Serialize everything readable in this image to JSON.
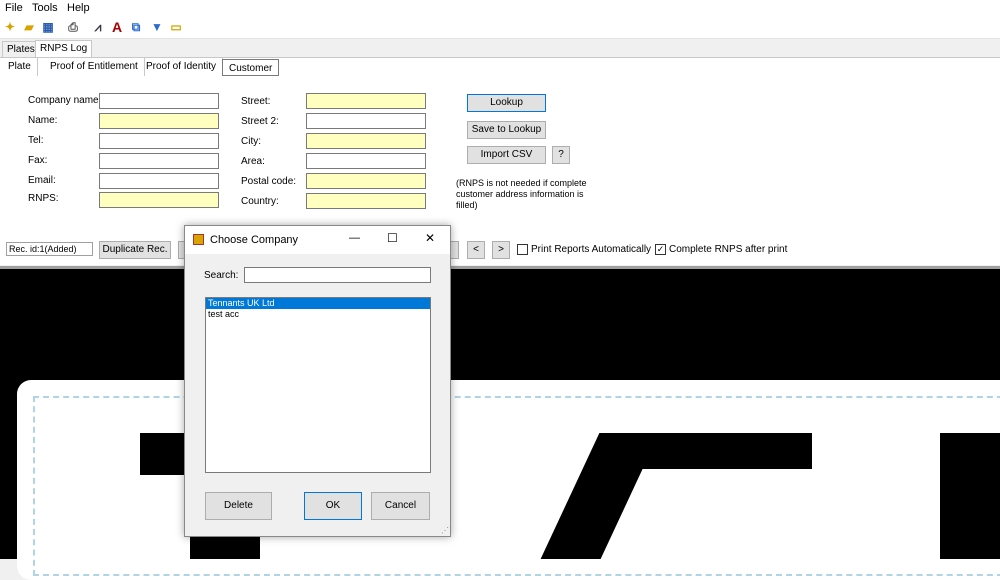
{
  "menu": [
    "File",
    "Tools",
    "Help"
  ],
  "toolbar_icons": [
    "new-icon",
    "open-icon",
    "image-icon",
    "print-icon",
    "find-icon",
    "font-icon",
    "copy-icon",
    "filter-icon",
    "label-icon"
  ],
  "top_tabs": [
    "Plates",
    "RNPS Log"
  ],
  "sub_tabs": [
    "Plate",
    "Proof of Entitlement",
    "Proof of Identity",
    "Customer"
  ],
  "form": {
    "left_labels": [
      "Company name:",
      "Name:",
      "Tel:",
      "Fax:",
      "Email:",
      "RNPS:"
    ],
    "right_labels": [
      "Street:",
      "Street 2:",
      "City:",
      "Area:",
      "Postal code:",
      "Country:"
    ],
    "lookup": "Lookup",
    "save_lookup": "Save to Lookup",
    "import_csv": "Import CSV",
    "help": "?",
    "note": "(RNPS is not needed if complete customer address information is filled)"
  },
  "footer": {
    "rec_id": "Rec. id:1(Added)",
    "duplicate": "Duplicate Rec.",
    "prev": "<",
    "next": ">",
    "print_auto": "Print Reports Automatically",
    "complete_rnps": "Complete RNPS after print",
    "print_auto_checked": false,
    "complete_rnps_checked": true
  },
  "dialog": {
    "title": "Choose Company",
    "search_label": "Search:",
    "search_value": "",
    "items": [
      "Tennants UK Ltd",
      "test acc"
    ],
    "selected_index": 0,
    "delete": "Delete",
    "ok": "OK",
    "cancel": "Cancel",
    "minimize": "—",
    "maximize": "☐",
    "close": "✕"
  },
  "colors": {
    "required_field": "#ffffc0",
    "selection": "#0078d7",
    "plate_dash": "#b0d4e6"
  }
}
